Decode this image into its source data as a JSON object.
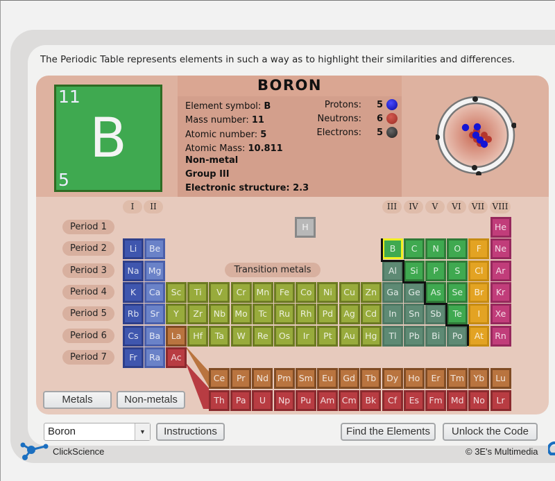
{
  "intro_text": "The Periodic Table represents elements in such a way as to highlight their similarities and differences.",
  "selected_element": {
    "name": "BORON",
    "symbol": "B",
    "mass_number": "11",
    "atomic_number": "5",
    "props": {
      "symbol_label": "Element symbol: ",
      "symbol_value": "B",
      "mass_label": "Mass number: ",
      "mass_value": "11",
      "atomic_label": "Atomic number: ",
      "atomic_value": "5",
      "amass_label": "Atomic Mass: ",
      "amass_value": "10.811",
      "type": "Non-metal",
      "group": "Group III",
      "structure": "Electronic structure: 2.3"
    },
    "particles": [
      {
        "label": "Protons:",
        "value": "5",
        "color": "#1a1ad0"
      },
      {
        "label": "Neutrons:",
        "value": "6",
        "color": "#b83a30"
      },
      {
        "label": "Electrons:",
        "value": "5",
        "color": "#333333"
      }
    ]
  },
  "groups": [
    "I",
    "II",
    "III",
    "IV",
    "V",
    "VI",
    "VII",
    "VIII"
  ],
  "periods": [
    "Period 1",
    "Period 2",
    "Period 3",
    "Period 4",
    "Period 5",
    "Period 6",
    "Period 7"
  ],
  "transition_label": "Transition metals",
  "colors": {
    "alkali": "#3f56ae",
    "alkaline_earth": "#6a82c8",
    "transition": "#98ab3c",
    "post_transition": "#5e8a74",
    "nonmetal": "#3fa950",
    "halogen": "#e3a323",
    "noble": "#c13d7a",
    "lanthanide": "#b9743f",
    "actinide": "#b83c42",
    "hydrogen": "#b8b8b8",
    "selection": "#f0f020"
  },
  "elements": [
    {
      "s": "H",
      "r": 0,
      "c": 8.2,
      "t": "h"
    },
    {
      "s": "He",
      "r": 0,
      "c": 17,
      "t": "nob"
    },
    {
      "s": "Li",
      "r": 1,
      "c": 0,
      "t": "alk"
    },
    {
      "s": "Be",
      "r": 1,
      "c": 1,
      "t": "ae"
    },
    {
      "s": "B",
      "r": 1,
      "c": 12,
      "t": "non",
      "sel": true
    },
    {
      "s": "C",
      "r": 1,
      "c": 13,
      "t": "non"
    },
    {
      "s": "N",
      "r": 1,
      "c": 14,
      "t": "non"
    },
    {
      "s": "O",
      "r": 1,
      "c": 15,
      "t": "non"
    },
    {
      "s": "F",
      "r": 1,
      "c": 16,
      "t": "hal"
    },
    {
      "s": "Ne",
      "r": 1,
      "c": 17,
      "t": "nob"
    },
    {
      "s": "Na",
      "r": 2,
      "c": 0,
      "t": "alk"
    },
    {
      "s": "Mg",
      "r": 2,
      "c": 1,
      "t": "ae"
    },
    {
      "s": "Al",
      "r": 2,
      "c": 12,
      "t": "post"
    },
    {
      "s": "Si",
      "r": 2,
      "c": 13,
      "t": "non"
    },
    {
      "s": "P",
      "r": 2,
      "c": 14,
      "t": "non"
    },
    {
      "s": "S",
      "r": 2,
      "c": 15,
      "t": "non"
    },
    {
      "s": "Cl",
      "r": 2,
      "c": 16,
      "t": "hal"
    },
    {
      "s": "Ar",
      "r": 2,
      "c": 17,
      "t": "nob"
    },
    {
      "s": "K",
      "r": 3,
      "c": 0,
      "t": "alk"
    },
    {
      "s": "Ca",
      "r": 3,
      "c": 1,
      "t": "ae"
    },
    {
      "s": "Sc",
      "r": 3,
      "c": 2,
      "t": "tm"
    },
    {
      "s": "Ti",
      "r": 3,
      "c": 3,
      "t": "tm"
    },
    {
      "s": "V",
      "r": 3,
      "c": 4,
      "t": "tm"
    },
    {
      "s": "Cr",
      "r": 3,
      "c": 5,
      "t": "tm"
    },
    {
      "s": "Mn",
      "r": 3,
      "c": 6,
      "t": "tm"
    },
    {
      "s": "Fe",
      "r": 3,
      "c": 7,
      "t": "tm"
    },
    {
      "s": "Co",
      "r": 3,
      "c": 8,
      "t": "tm"
    },
    {
      "s": "Ni",
      "r": 3,
      "c": 9,
      "t": "tm"
    },
    {
      "s": "Cu",
      "r": 3,
      "c": 10,
      "t": "tm"
    },
    {
      "s": "Zn",
      "r": 3,
      "c": 11,
      "t": "tm"
    },
    {
      "s": "Ga",
      "r": 3,
      "c": 12,
      "t": "post"
    },
    {
      "s": "Ge",
      "r": 3,
      "c": 13,
      "t": "post"
    },
    {
      "s": "As",
      "r": 3,
      "c": 14,
      "t": "non"
    },
    {
      "s": "Se",
      "r": 3,
      "c": 15,
      "t": "non"
    },
    {
      "s": "Br",
      "r": 3,
      "c": 16,
      "t": "hal"
    },
    {
      "s": "Kr",
      "r": 3,
      "c": 17,
      "t": "nob"
    },
    {
      "s": "Rb",
      "r": 4,
      "c": 0,
      "t": "alk"
    },
    {
      "s": "Sr",
      "r": 4,
      "c": 1,
      "t": "ae"
    },
    {
      "s": "Y",
      "r": 4,
      "c": 2,
      "t": "tm"
    },
    {
      "s": "Zr",
      "r": 4,
      "c": 3,
      "t": "tm"
    },
    {
      "s": "Nb",
      "r": 4,
      "c": 4,
      "t": "tm"
    },
    {
      "s": "Mo",
      "r": 4,
      "c": 5,
      "t": "tm"
    },
    {
      "s": "Tc",
      "r": 4,
      "c": 6,
      "t": "tm"
    },
    {
      "s": "Ru",
      "r": 4,
      "c": 7,
      "t": "tm"
    },
    {
      "s": "Rh",
      "r": 4,
      "c": 8,
      "t": "tm"
    },
    {
      "s": "Pd",
      "r": 4,
      "c": 9,
      "t": "tm"
    },
    {
      "s": "Ag",
      "r": 4,
      "c": 10,
      "t": "tm"
    },
    {
      "s": "Cd",
      "r": 4,
      "c": 11,
      "t": "tm"
    },
    {
      "s": "In",
      "r": 4,
      "c": 12,
      "t": "post"
    },
    {
      "s": "Sn",
      "r": 4,
      "c": 13,
      "t": "post"
    },
    {
      "s": "Sb",
      "r": 4,
      "c": 14,
      "t": "post"
    },
    {
      "s": "Te",
      "r": 4,
      "c": 15,
      "t": "non"
    },
    {
      "s": "I",
      "r": 4,
      "c": 16,
      "t": "hal"
    },
    {
      "s": "Xe",
      "r": 4,
      "c": 17,
      "t": "nob"
    },
    {
      "s": "Cs",
      "r": 5,
      "c": 0,
      "t": "alk"
    },
    {
      "s": "Ba",
      "r": 5,
      "c": 1,
      "t": "ae"
    },
    {
      "s": "La",
      "r": 5,
      "c": 2,
      "t": "lan"
    },
    {
      "s": "Hf",
      "r": 5,
      "c": 3,
      "t": "tm"
    },
    {
      "s": "Ta",
      "r": 5,
      "c": 4,
      "t": "tm"
    },
    {
      "s": "W",
      "r": 5,
      "c": 5,
      "t": "tm"
    },
    {
      "s": "Re",
      "r": 5,
      "c": 6,
      "t": "tm"
    },
    {
      "s": "Os",
      "r": 5,
      "c": 7,
      "t": "tm"
    },
    {
      "s": "Ir",
      "r": 5,
      "c": 8,
      "t": "tm"
    },
    {
      "s": "Pt",
      "r": 5,
      "c": 9,
      "t": "tm"
    },
    {
      "s": "Au",
      "r": 5,
      "c": 10,
      "t": "tm"
    },
    {
      "s": "Hg",
      "r": 5,
      "c": 11,
      "t": "tm"
    },
    {
      "s": "Tl",
      "r": 5,
      "c": 12,
      "t": "post"
    },
    {
      "s": "Pb",
      "r": 5,
      "c": 13,
      "t": "post"
    },
    {
      "s": "Bi",
      "r": 5,
      "c": 14,
      "t": "post"
    },
    {
      "s": "Po",
      "r": 5,
      "c": 15,
      "t": "post"
    },
    {
      "s": "At",
      "r": 5,
      "c": 16,
      "t": "hal"
    },
    {
      "s": "Rn",
      "r": 5,
      "c": 17,
      "t": "nob"
    },
    {
      "s": "Fr",
      "r": 6,
      "c": 0,
      "t": "alk"
    },
    {
      "s": "Ra",
      "r": 6,
      "c": 1,
      "t": "ae"
    },
    {
      "s": "Ac",
      "r": 6,
      "c": 2,
      "t": "act"
    }
  ],
  "lanthanides": [
    "Ce",
    "Pr",
    "Nd",
    "Pm",
    "Sm",
    "Eu",
    "Gd",
    "Tb",
    "Dy",
    "Ho",
    "Er",
    "Tm",
    "Yb",
    "Lu"
  ],
  "actinides": [
    "Th",
    "Pa",
    "U",
    "Np",
    "Pu",
    "Am",
    "Cm",
    "Bk",
    "Cf",
    "Es",
    "Fm",
    "Md",
    "No",
    "Lr"
  ],
  "buttons": {
    "metals": "Metals",
    "nonmetals": "Non-metals",
    "instructions": "Instructions",
    "find": "Find the Elements",
    "unlock": "Unlock the Code"
  },
  "element_select": {
    "value": "Boron",
    "arrow": "▼"
  },
  "footer": {
    "brand": "ClickScience",
    "copyright": "© 3E's Multimedia"
  }
}
